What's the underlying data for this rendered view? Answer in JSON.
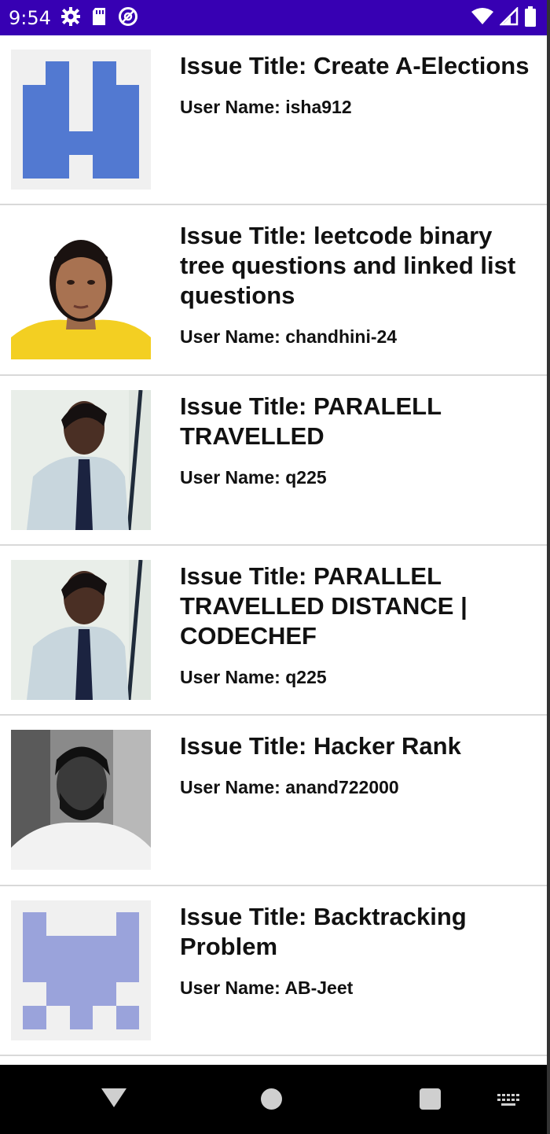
{
  "status_bar": {
    "time": "9:54",
    "icons_left": [
      "gear-icon",
      "sd-card-icon",
      "no-tracking-icon"
    ],
    "icons_right": [
      "wifi-icon",
      "signal-icon",
      "battery-icon"
    ],
    "background": "#3700b3"
  },
  "issues": [
    {
      "title": "Issue Title: Create A-Elections",
      "user": "User Name: isha912",
      "avatar": "identicon-blue"
    },
    {
      "title": "Issue Title: leetcode binary tree questions and linked list questions",
      "user": "User Name: chandhini-24",
      "avatar": "photo-girl-yellow-shirt"
    },
    {
      "title": "Issue Title: PARALELL TRAVELLED",
      "user": "User Name: q225",
      "avatar": "photo-boy-tie"
    },
    {
      "title": "Issue Title: PARALLEL TRAVELLED DISTANCE | CODECHEF",
      "user": "User Name: q225",
      "avatar": "photo-boy-tie"
    },
    {
      "title": "Issue Title: Hacker Rank",
      "user": "User Name: anand722000",
      "avatar": "photo-man-bw"
    },
    {
      "title": "Issue Title: Backtracking Problem",
      "user": "User Name: AB-Jeet",
      "avatar": "identicon-lavender"
    }
  ],
  "nav_bar": {
    "icons": [
      "back-icon",
      "home-icon",
      "recents-icon",
      "keyboard-icon"
    ]
  }
}
